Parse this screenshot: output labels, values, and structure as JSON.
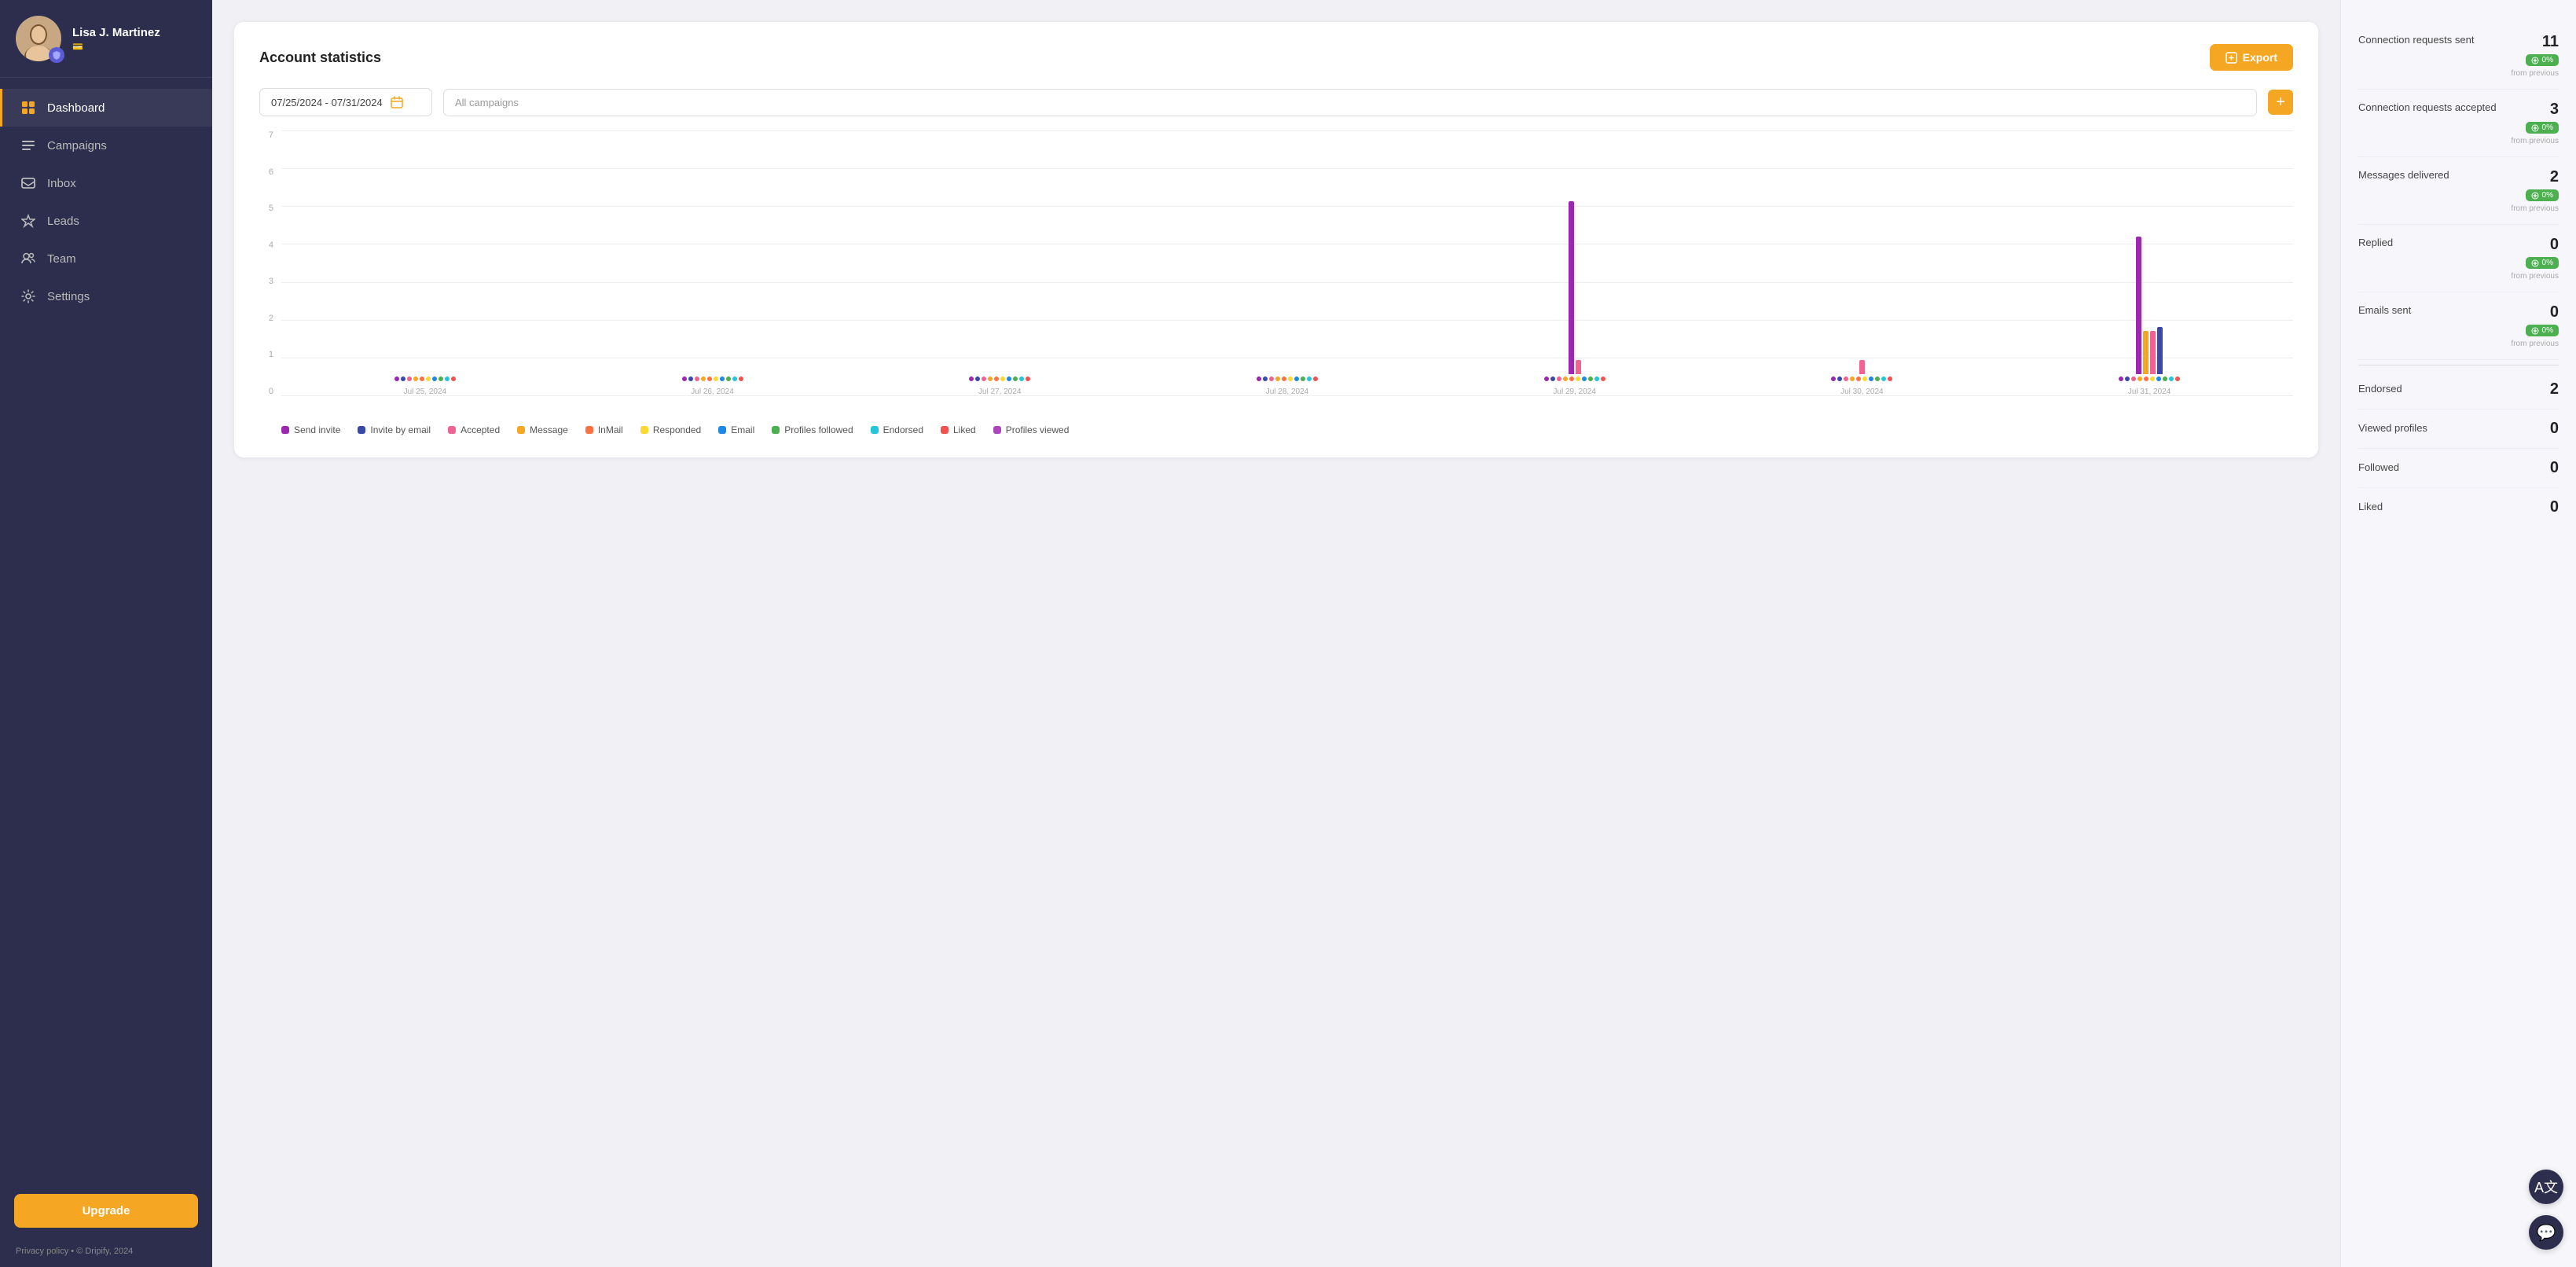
{
  "sidebar": {
    "profile": {
      "name": "Lisa J. Martinez",
      "subtitle": "💳"
    },
    "nav": [
      {
        "id": "dashboard",
        "label": "Dashboard",
        "active": true
      },
      {
        "id": "campaigns",
        "label": "Campaigns",
        "active": false
      },
      {
        "id": "inbox",
        "label": "Inbox",
        "active": false
      },
      {
        "id": "leads",
        "label": "Leads",
        "active": false
      },
      {
        "id": "team",
        "label": "Team",
        "active": false
      },
      {
        "id": "settings",
        "label": "Settings",
        "active": false
      }
    ],
    "upgrade_label": "Upgrade",
    "footer": "Privacy policy  •  © Dripify, 2024"
  },
  "main": {
    "title": "Account statistics",
    "export_label": "Export",
    "date_range": "07/25/2024  -  07/31/2024",
    "campaigns_placeholder": "All campaigns",
    "chart": {
      "y_labels": [
        "0",
        "1",
        "2",
        "3",
        "4",
        "5",
        "6",
        "7"
      ],
      "days": [
        {
          "label": "Jul 25, 2024",
          "bars": []
        },
        {
          "label": "Jul 26, 2024",
          "bars": []
        },
        {
          "label": "Jul 27, 2024",
          "bars": []
        },
        {
          "label": "Jul 28, 2024",
          "bars": []
        },
        {
          "label": "Jul 29, 2024",
          "bars": [
            {
              "color": "#9c27b0",
              "height": 95
            },
            {
              "color": "#f06292",
              "height": 14
            }
          ]
        },
        {
          "label": "Jul 30, 2024",
          "bars": [
            {
              "color": "#f06292",
              "height": 14
            }
          ]
        },
        {
          "label": "Jul 31, 2024",
          "bars": [
            {
              "color": "#9c27b0",
              "height": 79
            },
            {
              "color": "#f5a623",
              "height": 30
            },
            {
              "color": "#f06292",
              "height": 30
            },
            {
              "color": "#3949ab",
              "height": 32
            }
          ]
        }
      ]
    },
    "legend": [
      {
        "label": "Send invite",
        "color": "#9c27b0"
      },
      {
        "label": "Invite by email",
        "color": "#3949ab"
      },
      {
        "label": "Accepted",
        "color": "#f06292"
      },
      {
        "label": "Message",
        "color": "#f5a623"
      },
      {
        "label": "InMail",
        "color": "#ff7043"
      },
      {
        "label": "Responded",
        "color": "#fdd835"
      },
      {
        "label": "Email",
        "color": "#1e88e5"
      },
      {
        "label": "Profiles followed",
        "color": "#4caf50"
      },
      {
        "label": "Endorsed",
        "color": "#26c6da"
      },
      {
        "label": "Liked",
        "color": "#ef5350"
      },
      {
        "label": "Profiles viewed",
        "color": "#ab47bc"
      }
    ]
  },
  "stats": {
    "items_with_badge": [
      {
        "label": "Connection requests sent",
        "value": "11",
        "badge": "0%",
        "from": "from previous"
      },
      {
        "label": "Connection requests accepted",
        "value": "3",
        "badge": "0%",
        "from": "from previous"
      },
      {
        "label": "Messages delivered",
        "value": "2",
        "badge": "0%",
        "from": "from previous"
      },
      {
        "label": "Replied",
        "value": "0",
        "badge": "0%",
        "from": "from previous"
      },
      {
        "label": "Emails sent",
        "value": "0",
        "badge": "0%",
        "from": "from previous"
      }
    ],
    "items_simple": [
      {
        "label": "Endorsed",
        "value": "2"
      },
      {
        "label": "Viewed profiles",
        "value": "0"
      },
      {
        "label": "Followed",
        "value": "0"
      },
      {
        "label": "Liked",
        "value": "0"
      }
    ]
  },
  "fabs": {
    "translate": "A文",
    "chat": "💬"
  }
}
